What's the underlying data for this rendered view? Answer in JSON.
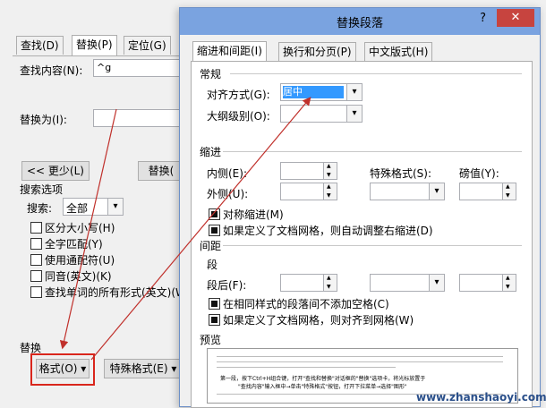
{
  "back": {
    "tabs": [
      "查找(D)",
      "替换(P)",
      "定位(G)"
    ],
    "find_label": "查找内容(N):",
    "find_value": "^g",
    "replace_label": "替换为(I):",
    "less_button": "<< 更少(L)",
    "replace_button": "替换(",
    "search_options_title": "搜索选项",
    "search_label": "搜索:",
    "search_value": "全部",
    "checkboxes": [
      "区分大小写(H)",
      "全字匹配(Y)",
      "使用通配符(U)",
      "同音(英文)(K)",
      "查找单词的所有形式(英文)(W)"
    ],
    "replace_section": "替换",
    "format_button": "格式(O) ▾",
    "special_button": "特殊格式(E) ▾"
  },
  "front": {
    "title": "替换段落",
    "help": "?",
    "close": "✕",
    "tabs": [
      "缩进和间距(I)",
      "换行和分页(P)",
      "中文版式(H)"
    ],
    "general_title": "常规",
    "align_label": "对齐方式(G):",
    "align_value": "居中",
    "outline_label": "大纲级别(O):",
    "indent_title": "缩进",
    "inner_label": "内侧(E):",
    "outer_label": "外侧(U):",
    "special_label": "特殊格式(S):",
    "degree_label": "磅值(Y):",
    "sym_indent": "对称缩进(M)",
    "grid_indent": "如果定义了文档网格，则自动调整右缩进(D)",
    "spacing_title": "间距",
    "before_label": "段",
    "after_label": "段后(F):",
    "no_space": "在相同样式的段落间不添加空格(C)",
    "snap_grid": "如果定义了文档网格，则对齐到网格(W)",
    "preview_title": "预览",
    "preview_text1": "第一段，按下Ctrl+H组合键，打开\"查找和替换\"对话框的\"替换\"选项卡，将光标放置于",
    "preview_text2": "\"查找内容\"输入框中→单击\"特殊格式\"按钮，打开下拉菜单→选择\"图形\"",
    "watermark": "www.zhanshaoyi.com"
  },
  "colors": {
    "titlebar": "#7aa3e0",
    "close": "#c7443f",
    "arrow": "#c0302b",
    "highlight": "#d9261c",
    "select": "#3399ff"
  }
}
